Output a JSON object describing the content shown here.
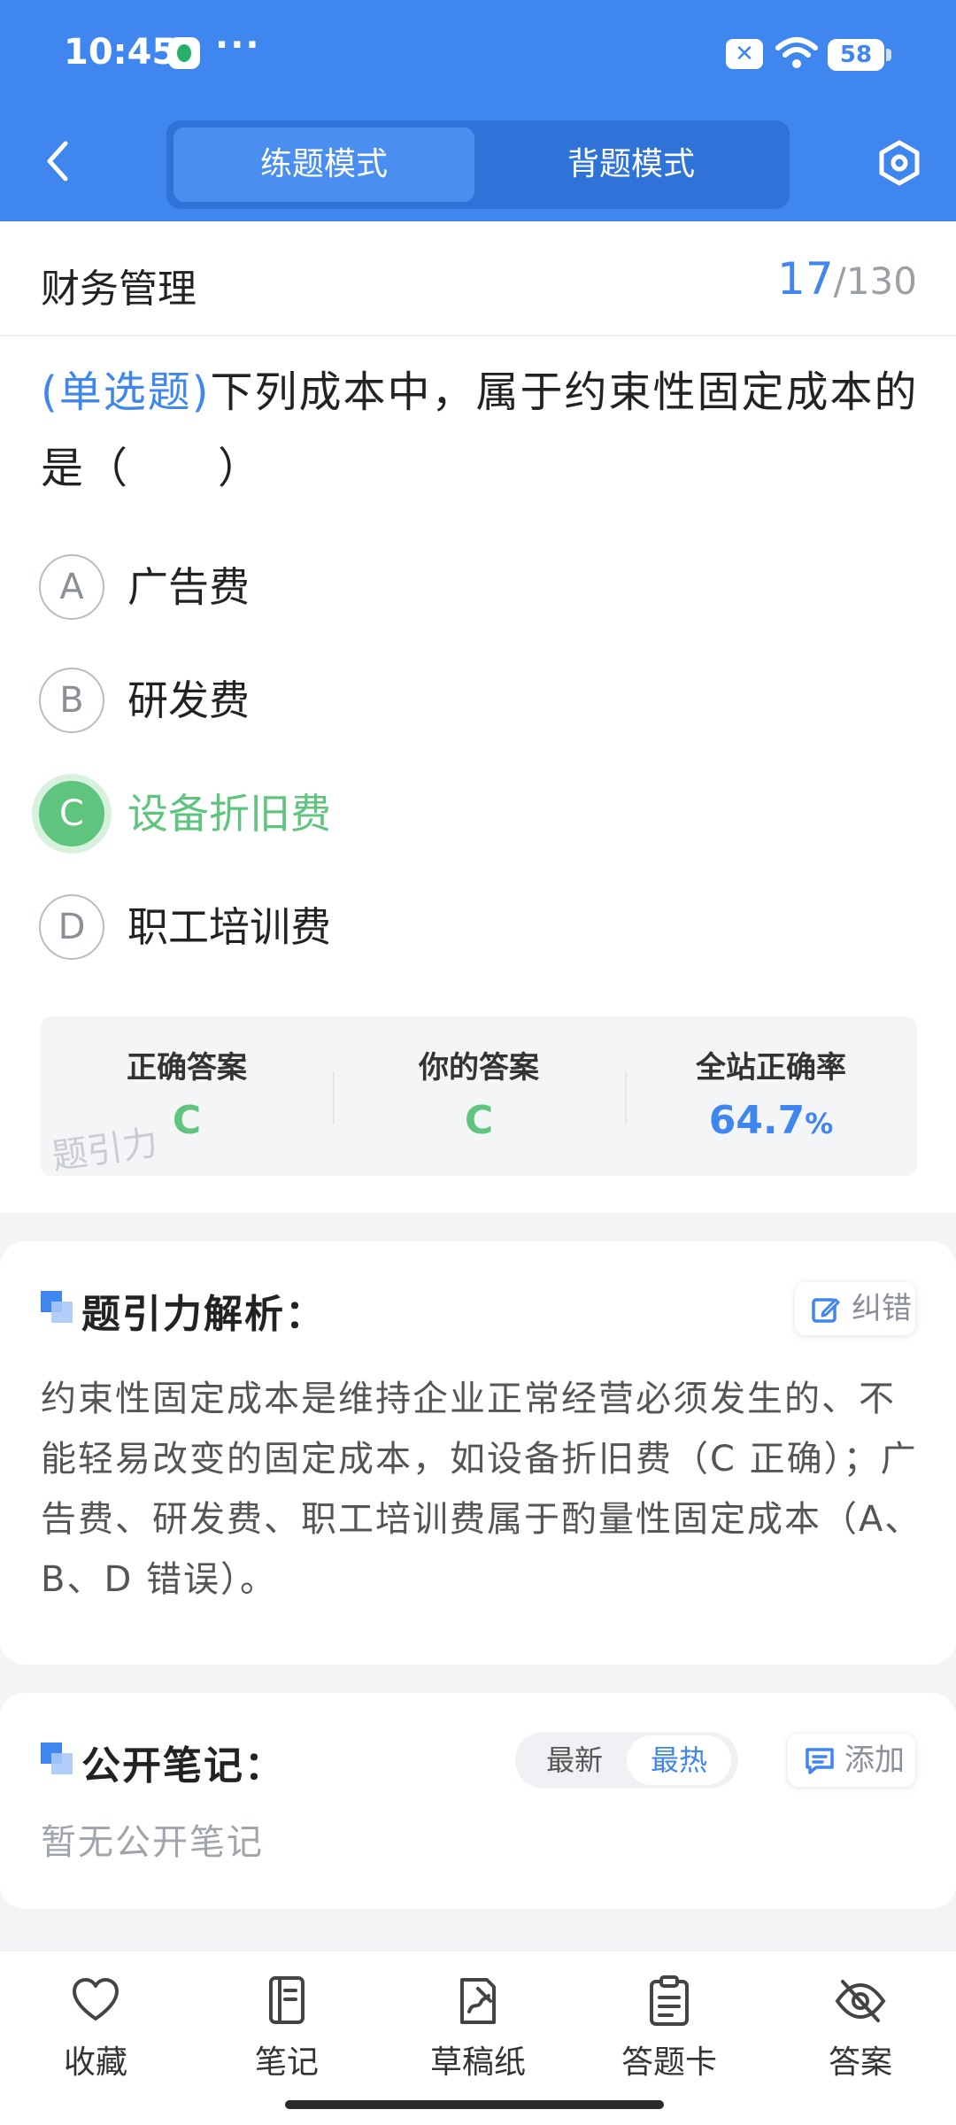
{
  "status_bar": {
    "time": "10:45",
    "dots": "···",
    "battery": "58"
  },
  "header": {
    "modes": [
      "练题模式",
      "背题模式"
    ],
    "active_mode": "练题模式"
  },
  "question_header": {
    "subject": "财务管理",
    "current": "17",
    "total": "/130"
  },
  "question": {
    "type": "(单选题)",
    "text": "下列成本中，属于约束性固定成本的是（　　）",
    "options": [
      {
        "letter": "A",
        "text": "广告费",
        "state": "normal"
      },
      {
        "letter": "B",
        "text": "研发费",
        "state": "normal"
      },
      {
        "letter": "C",
        "text": "设备折旧费",
        "state": "correct"
      },
      {
        "letter": "D",
        "text": "职工培训费",
        "state": "normal"
      }
    ]
  },
  "stats": {
    "correct_answer_label": "正确答案",
    "correct_answer": "C",
    "your_answer_label": "你的答案",
    "your_answer": "C",
    "accuracy_label": "全站正确率",
    "accuracy_value": "64.7",
    "accuracy_unit": "%",
    "watermark": "题引力"
  },
  "analysis": {
    "title": "题引力解析：",
    "report_label": "纠错",
    "text": "约束性固定成本是维持企业正常经营必须发生的、不能轻易改变的固定成本，如设备折旧费（C 正确）；广告费、研发费、职工培训费属于酌量性固定成本（A、B、D 错误）。"
  },
  "notes": {
    "title": "公开笔记：",
    "sort_options": [
      "最新",
      "最热"
    ],
    "active_sort": "最热",
    "add_label": "添加",
    "empty_text": "暂无公开笔记"
  },
  "bottom_bar": {
    "items": [
      {
        "label": "收藏",
        "icon": "heart-icon"
      },
      {
        "label": "笔记",
        "icon": "notebook-icon"
      },
      {
        "label": "草稿纸",
        "icon": "draft-paper-icon"
      },
      {
        "label": "答题卡",
        "icon": "answer-sheet-icon"
      },
      {
        "label": "答案",
        "icon": "eye-off-icon"
      }
    ]
  },
  "colors": {
    "primary": "#3f86ee",
    "correct": "#5ec47e"
  }
}
